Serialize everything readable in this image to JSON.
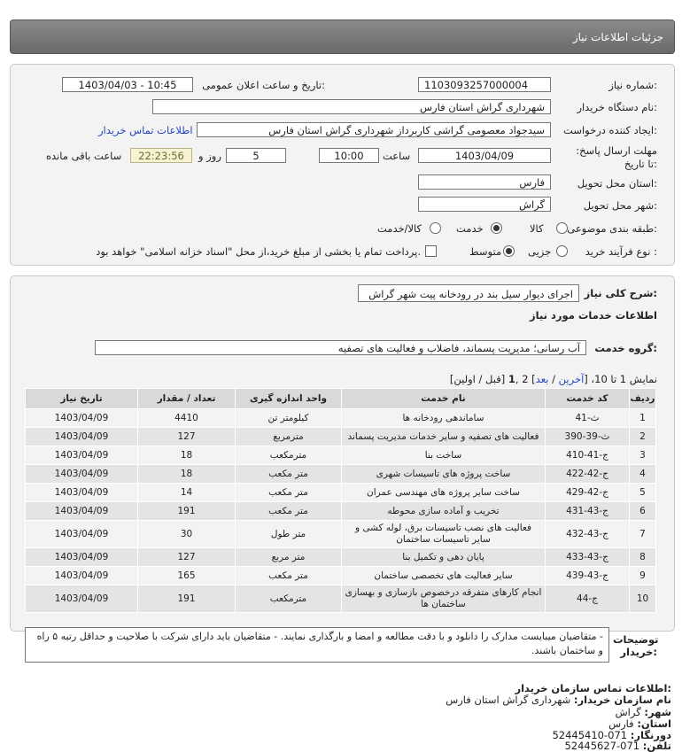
{
  "header": {
    "title": "جزئیات اطلاعات نیاز"
  },
  "form": {
    "need_number_label": "شماره نیاز:",
    "need_number": "1103093257000004",
    "announce_label": "تاریخ و ساعت اعلان عمومی:",
    "announce_value": "1403/04/03 - 10:45",
    "buyer_org_label": "نام دستگاه خریدار:",
    "buyer_org": "شهرداری گراش استان فارس",
    "creator_label": "ایجاد کننده درخواست:",
    "creator": "سیدجواد معصومی گراشی کاربرداز شهرداری گراش استان فارس",
    "contact_link": "اطلاعات تماس خریدار",
    "deadline_label": "مهلت ارسال پاسخ: تا تاریخ:",
    "deadline_date": "1403/04/09",
    "time_label": "ساعت",
    "deadline_time": "10:00",
    "days_value": "5",
    "days_label": "روز و",
    "remaining_time": "22:23:56",
    "remaining_label": "ساعت باقی مانده",
    "province_label": "استان محل تحویل:",
    "province": "فارس",
    "city_label": "شهر محل تحویل:",
    "city": "گراش",
    "category_label": "طبقه بندی موضوعی:",
    "category_options": [
      "کالا",
      "خدمت",
      "کالا/خدمت"
    ],
    "process_label": "نوع فرآیند خرید :",
    "process_options": [
      "جزیی",
      "متوسط"
    ],
    "payment_text": "پرداخت تمام یا بخشی از مبلغ خرید،از محل \"اسناد خزانه اسلامی\" خواهد بود."
  },
  "summary": {
    "label": "شرح کلی نیاز:",
    "value": "اجرای دیوار سیل بند در رودخانه پیت شهر گراش",
    "services_heading": "اطلاعات خدمات مورد نیاز",
    "group_label": "گروه خدمت:",
    "group_value": "آب رسانی؛ مدیریت پسماند، فاضلاب و فعالیت های تصفیه",
    "pagination": {
      "prefix": "نمایش 1 تا 10، [",
      "last": "آخرین",
      "sep1": " / ",
      "next": "بعد",
      "mid": "] 2 ,",
      "current": "1",
      "suffix": " [قبل / اولین]"
    }
  },
  "table": {
    "headers": [
      "ردیف",
      "کد خدمت",
      "نام خدمت",
      "واحد اندازه گیری",
      "تعداد / مقدار",
      "تاریخ نیاز"
    ],
    "rows": [
      {
        "n": "1",
        "code": "ث-41",
        "name": "ساماندهی رودخانه ها",
        "unit": "کیلومتر تن",
        "qty": "4410",
        "date": "1403/04/09"
      },
      {
        "n": "2",
        "code": "ث-39-390",
        "name": "فعالیت های تصفیه و سایر خدمات مدیریت پسماند",
        "unit": "مترمربع",
        "qty": "127",
        "date": "1403/04/09"
      },
      {
        "n": "3",
        "code": "ج-41-410",
        "name": "ساخت بنا",
        "unit": "مترمکعب",
        "qty": "18",
        "date": "1403/04/09"
      },
      {
        "n": "4",
        "code": "ج-42-422",
        "name": "ساخت پروژه های تاسیسات شهری",
        "unit": "متر مکعب",
        "qty": "18",
        "date": "1403/04/09"
      },
      {
        "n": "5",
        "code": "ج-42-429",
        "name": "ساخت سایر پروژه های مهندسی عمران",
        "unit": "متر مکعب",
        "qty": "14",
        "date": "1403/04/09"
      },
      {
        "n": "6",
        "code": "ج-43-431",
        "name": "تخریب و آماده سازی محوطه",
        "unit": "متر مکعب",
        "qty": "191",
        "date": "1403/04/09"
      },
      {
        "n": "7",
        "code": "ج-43-432",
        "name": "فعالیت های نصب تاسیسات برق، لوله کشی و سایر تاسیسات ساختمان",
        "unit": "متر طول",
        "qty": "30",
        "date": "1403/04/09"
      },
      {
        "n": "8",
        "code": "ج-43-433",
        "name": "پایان دهی و تکمیل بنا",
        "unit": "متر مربع",
        "qty": "127",
        "date": "1403/04/09"
      },
      {
        "n": "9",
        "code": "ج-43-439",
        "name": "سایر فعالیت های تخصصی ساختمان",
        "unit": "متر مکعب",
        "qty": "165",
        "date": "1403/04/09"
      },
      {
        "n": "10",
        "code": "ج-44",
        "name": "انجام کارهای متفرقه درخصوص بازسازی و بهسازی ساختمان ها",
        "unit": "مترمکعب",
        "qty": "191",
        "date": "1403/04/09"
      }
    ]
  },
  "notes": {
    "label": "توضیحات خریدار:",
    "text": "- متقاضیان میبایست مدارک را دانلود و با دقت مطالعه و امضا و بارگذاری نمایند. - متقاضیان باید دارای شرکت با صلاحیت و حداقل رتبه ۵ راه و ساختمان باشند."
  },
  "contact": {
    "heading": "اطلاعات تماس سازمان خریدار:",
    "org_label": "نام سازمان خریدار:",
    "org": "شهرداری گراش استان فارس",
    "city_label": "شهر:",
    "city": "گراش",
    "province_label": "استان:",
    "province": "فارس",
    "fax_label": "دورنگار:",
    "fax": "071-52445410",
    "phone_label": "تلفن:",
    "phone": "071-52445627"
  }
}
